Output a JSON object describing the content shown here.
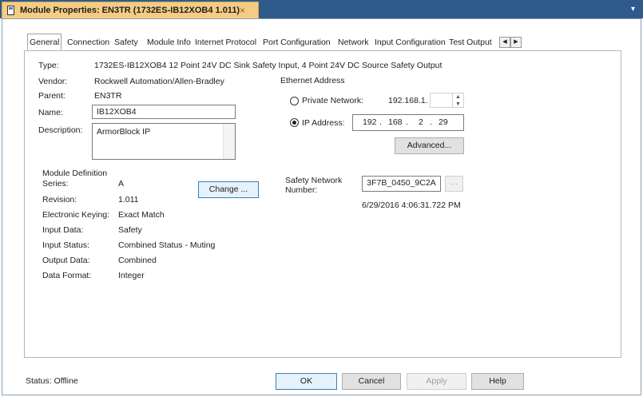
{
  "window": {
    "doc_title": "Module Properties: EN3TR (1732ES-IB12XOB4 1.011)",
    "close_glyph": "×",
    "strip_arrow": "▾"
  },
  "tabs": [
    {
      "label": "General",
      "active": true
    },
    {
      "label": "Connection"
    },
    {
      "label": "Safety"
    },
    {
      "label": "Module Info"
    },
    {
      "label": "Internet Protocol"
    },
    {
      "label": "Port Configuration"
    },
    {
      "label": "Network"
    },
    {
      "label": "Input Configuration"
    },
    {
      "label": "Test Output"
    }
  ],
  "tab_scroll": {
    "left": "◀",
    "right": "▶"
  },
  "general": {
    "type_label": "Type:",
    "type_value": "1732ES-IB12XOB4 12 Point 24V DC Sink Safety Input, 4 Point 24V DC Source Safety Output",
    "vendor_label": "Vendor:",
    "vendor_value": "Rockwell Automation/Allen-Bradley",
    "parent_label": "Parent:",
    "parent_value": "EN3TR",
    "name_label": "Name:",
    "name_value": "IB12XOB4",
    "description_label": "Description:",
    "description_value": "ArmorBlock IP"
  },
  "ethernet": {
    "heading": "Ethernet Address",
    "private_network_label": "Private Network:",
    "private_network_prefix": "192.168.1.",
    "ip_address_label": "IP Address:",
    "ip_octets": [
      "192",
      "168",
      "2",
      "29"
    ],
    "advanced_button": "Advanced..."
  },
  "module_definition": {
    "heading": "Module Definition",
    "rows": [
      {
        "label": "Series:",
        "value": "A"
      },
      {
        "label": "Revision:",
        "value": "1.011"
      },
      {
        "label": "Electronic Keying:",
        "value": "Exact Match"
      },
      {
        "label": "Input Data:",
        "value": "Safety"
      },
      {
        "label": "Input Status:",
        "value": "Combined Status - Muting"
      },
      {
        "label": "Output Data:",
        "value": "Combined"
      },
      {
        "label": "Data Format:",
        "value": "Integer"
      }
    ],
    "change_button": "Change ..."
  },
  "safety_network": {
    "label_line1": "Safety Network",
    "label_line2": "Number:",
    "value": "3F7B_0450_9C2A",
    "browse_button": "...",
    "timestamp": "6/29/2016 4:06:31.722 PM"
  },
  "footer": {
    "status": "Status:  Offline",
    "ok": "OK",
    "cancel": "Cancel",
    "apply": "Apply",
    "help": "Help"
  },
  "colors": {
    "doc_tab": "#f5cc84",
    "tabstrip": "#2e5a8c",
    "focus_border": "#3c7fb1"
  }
}
